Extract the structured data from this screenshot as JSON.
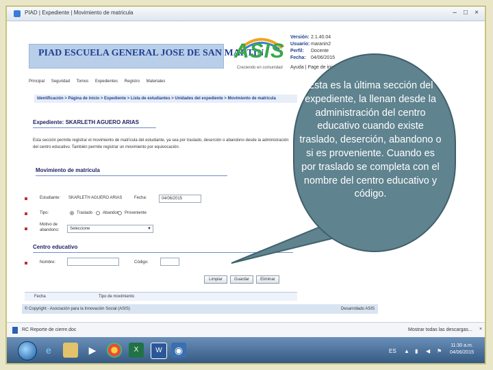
{
  "window": {
    "title": "PIAD | Expediente | Movimiento de matricula",
    "min_icon": "minimize-icon",
    "max_icon": "maximize-icon",
    "close_icon": "close-icon"
  },
  "banner": {
    "school_name": "PIAD ESCUELA GENERAL JOSE DE SAN MARTIN",
    "logo_text": "ASIS",
    "logo_tagline": "Creciendo en comunidad"
  },
  "info": {
    "version_label": "Versión:",
    "version_value": "2.1.40.04",
    "user_label": "Usuario:",
    "user_value": "maranin2",
    "profile_label": "Perfil:",
    "profile_value": "Docente",
    "date_label": "Fecha:",
    "date_value": "04/06/2015",
    "links": "Ayuda | Page de inicio | Cerrar"
  },
  "nav": {
    "items": [
      "Principal",
      "Seguridad",
      "Tomos",
      "Expedientes",
      "Registro",
      "Materiales"
    ]
  },
  "breadcrumb": "Identificación > Página de inicio > Expediente > Lista de estudiantes > Unidades del expediente > Movimiento de matrícula",
  "expediente": {
    "title": "Expediente: SKARLETH AGUERO ARIAS",
    "description": "Esta sección permite registrar el movimiento de matrícula del estudiante, ya sea por traslado, deserción o abandono desde la administración del centro educativo. También permite registrar un movimiento por equivocación."
  },
  "form": {
    "section_title": "Movimiento de matrícula",
    "student_label": "Estudiante:",
    "student_value": "SKARLETH AGUERO ARIAS",
    "date_label": "Fecha:",
    "date_value": "04/06/2015",
    "type_label": "Tipo:",
    "type_options": [
      "Traslado",
      "Abandono",
      "Proveniente"
    ],
    "type_selected": "Traslado",
    "reason_label": "Motivo de abandono:",
    "reason_value": "Seleccione",
    "center_section": "Centro educativo",
    "name_label": "Nombre:",
    "code_label": "Código:"
  },
  "buttons": {
    "clean": "Limpiar",
    "save": "Guardar",
    "delete": "Eliminar"
  },
  "table": {
    "col_date": "Fecha",
    "col_type": "Tipo de movimiento"
  },
  "footer": {
    "left": "© Copyright - Asociación para la Innovación Social (ASIS)",
    "right": "Desarrollado ASIS"
  },
  "callout": {
    "text": "Esta es la última sección del expediente, la llenan desde la administración del centro educativo cuando existe traslado, deserción, abandono o si es proveniente. Cuando es por traslado se completa con el nombre del centro educativo y código."
  },
  "downloads": {
    "file_name": "RC Reporte de cierre.doc",
    "show_all": "Mostrar todas las descargas..."
  },
  "taskbar": {
    "lang": "ES",
    "time": "11:30 a.m.",
    "date": "04/06/2015"
  }
}
